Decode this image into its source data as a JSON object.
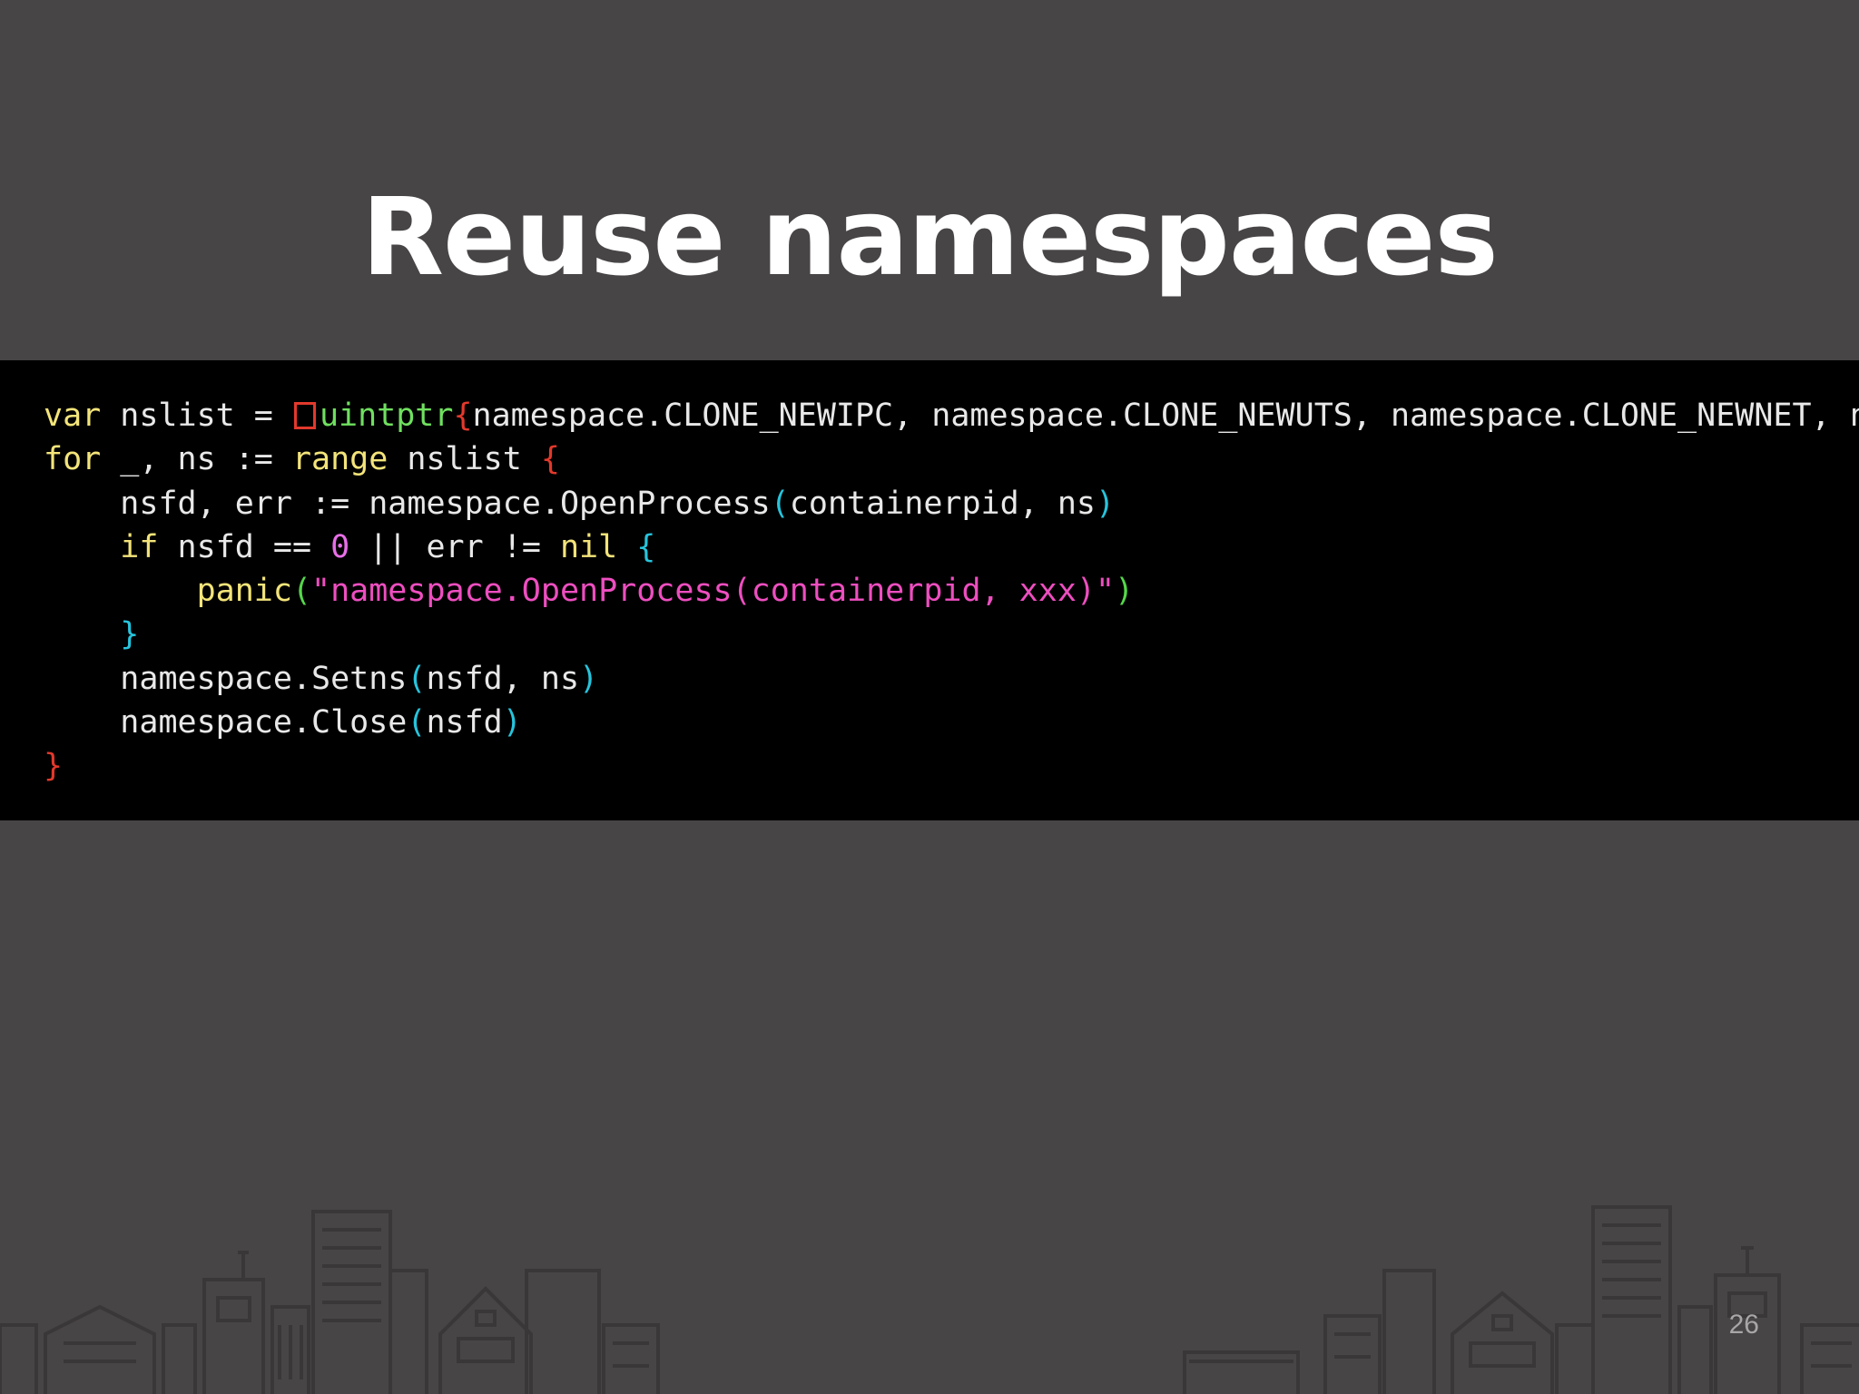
{
  "slide": {
    "title": "Reuse namespaces",
    "page_number": "26"
  },
  "code": {
    "lines": [
      {
        "indent": "",
        "tokens": [
          {
            "t": "var",
            "c": "kw"
          },
          {
            "t": " nslist = ",
            "c": "id"
          },
          {
            "t": "",
            "c": "box-red"
          },
          {
            "t": "uintptr",
            "c": "type"
          },
          {
            "t": "{",
            "c": "brace-red"
          },
          {
            "t": "namespace.CLONE_NEWIPC, namespace.CLONE_NEWUTS, namespace.CLONE_NEWNET, namesp",
            "c": "id"
          }
        ]
      },
      {
        "indent": "",
        "tokens": [
          {
            "t": "for",
            "c": "kw"
          },
          {
            "t": " _, ns := ",
            "c": "id"
          },
          {
            "t": "range",
            "c": "kw"
          },
          {
            "t": " nslist ",
            "c": "id"
          },
          {
            "t": "{",
            "c": "brace-red"
          }
        ]
      },
      {
        "indent": "    ",
        "tokens": [
          {
            "t": "nsfd, err := namespace.OpenProcess",
            "c": "id"
          },
          {
            "t": "(",
            "c": "paren-cyan"
          },
          {
            "t": "containerpid, ns",
            "c": "id"
          },
          {
            "t": ")",
            "c": "paren-cyan"
          }
        ]
      },
      {
        "indent": "    ",
        "tokens": [
          {
            "t": "if",
            "c": "kw"
          },
          {
            "t": " nsfd == ",
            "c": "id"
          },
          {
            "t": "0",
            "c": "num"
          },
          {
            "t": " || err != ",
            "c": "id"
          },
          {
            "t": "nil",
            "c": "kw"
          },
          {
            "t": " ",
            "c": "id"
          },
          {
            "t": "{",
            "c": "brace-cyan"
          }
        ]
      },
      {
        "indent": "        ",
        "tokens": [
          {
            "t": "panic",
            "c": "kw"
          },
          {
            "t": "(",
            "c": "paren-green"
          },
          {
            "t": "\"namespace.OpenProcess(containerpid, xxx)\"",
            "c": "str"
          },
          {
            "t": ")",
            "c": "paren-green"
          }
        ]
      },
      {
        "indent": "    ",
        "tokens": [
          {
            "t": "}",
            "c": "brace-cyan"
          }
        ]
      },
      {
        "indent": "    ",
        "tokens": [
          {
            "t": "namespace.Setns",
            "c": "id"
          },
          {
            "t": "(",
            "c": "paren-cyan"
          },
          {
            "t": "nsfd, ns",
            "c": "id"
          },
          {
            "t": ")",
            "c": "paren-cyan"
          }
        ]
      },
      {
        "indent": "    ",
        "tokens": [
          {
            "t": "namespace.Close",
            "c": "id"
          },
          {
            "t": "(",
            "c": "paren-cyan"
          },
          {
            "t": "nsfd",
            "c": "id"
          },
          {
            "t": ")",
            "c": "paren-cyan"
          }
        ]
      },
      {
        "indent": "",
        "tokens": [
          {
            "t": "}",
            "c": "brace-red"
          }
        ]
      }
    ]
  },
  "decoration": {
    "footer_illustration": "city-skyline-outline"
  },
  "colors": {
    "background": "#484546",
    "code_background": "#000000",
    "keyword": "#f3e47a",
    "type": "#6fe05f",
    "brace_red": "#e2392c",
    "cyan": "#27c4dc",
    "number": "#e86fe8",
    "string": "#ee4ec0"
  }
}
